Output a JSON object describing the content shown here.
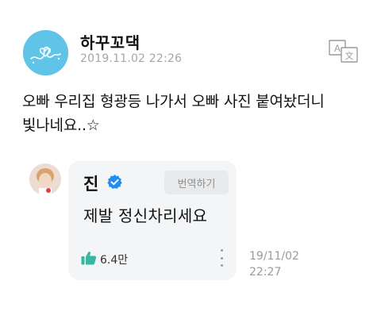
{
  "post": {
    "author": "하꾸꼬댁",
    "timestamp": "2019.11.02 22:26",
    "text_line1": "오빠 우리집 형광등 나가서 오빠 사진 붙여놨더니",
    "text_line2": "빛나네요..☆",
    "avatar_icon": "heart-scribble-logo-icon",
    "translate_icon": "translate-icon"
  },
  "reply": {
    "author": "진",
    "verified_icon": "verified-badge-icon",
    "translate_label": "번역하기",
    "text": "제발 정신차리세요",
    "likes": "6.4만",
    "like_icon": "thumbs-up-icon",
    "more_icon": "more-vertical-icon",
    "date": "19/11/02",
    "time": "22:27"
  },
  "colors": {
    "avatar_bg": "#5fc4e8",
    "bubble_bg": "#f4f5f7",
    "verified_blue": "#1e8ef5",
    "like_teal": "#35b7a0",
    "muted_gray": "#a6a6a6"
  }
}
